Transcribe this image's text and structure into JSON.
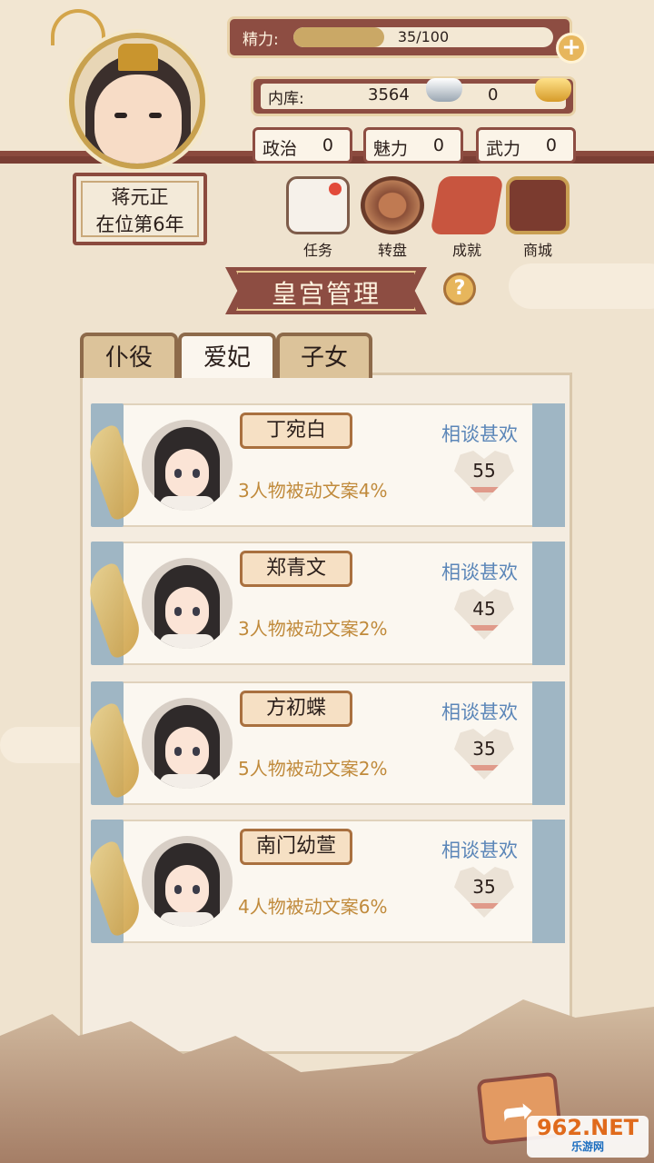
{
  "player": {
    "name": "蒋元正",
    "reign": "在位第6年"
  },
  "energy": {
    "label": "精力:",
    "text": "35/100",
    "fraction": 0.35
  },
  "vault": {
    "label": "内库:",
    "silver": "3564",
    "gold": "0"
  },
  "stats": [
    {
      "label": "政治",
      "value": "0"
    },
    {
      "label": "魅力",
      "value": "0"
    },
    {
      "label": "武力",
      "value": "0"
    }
  ],
  "features": [
    {
      "label": "任务",
      "icon": "task-scroll-icon"
    },
    {
      "label": "转盘",
      "icon": "wheel-icon"
    },
    {
      "label": "成就",
      "icon": "achievement-icon"
    },
    {
      "label": "商城",
      "icon": "shop-icon"
    }
  ],
  "title": "皇宫管理",
  "help": "?",
  "tabs": [
    {
      "label": "仆役",
      "active": false
    },
    {
      "label": "爱妃",
      "active": true
    },
    {
      "label": "子女",
      "active": false
    }
  ],
  "consorts": [
    {
      "name": "丁宛白",
      "desc": "3人物被动文案4%",
      "mood": "相谈甚欢",
      "affection": "55"
    },
    {
      "name": "郑青文",
      "desc": "3人物被动文案2%",
      "mood": "相谈甚欢",
      "affection": "45"
    },
    {
      "name": "方初蝶",
      "desc": "5人物被动文案2%",
      "mood": "相谈甚欢",
      "affection": "35"
    },
    {
      "name": "南门幼萱",
      "desc": "4人物被动文案6%",
      "mood": "相谈甚欢",
      "affection": "35"
    }
  ],
  "watermark": {
    "main": "962.NET",
    "sub": "乐游网"
  },
  "colors": {
    "accent": "#8d4d42",
    "mood": "#5b86b8",
    "desc": "#c08a3b"
  }
}
